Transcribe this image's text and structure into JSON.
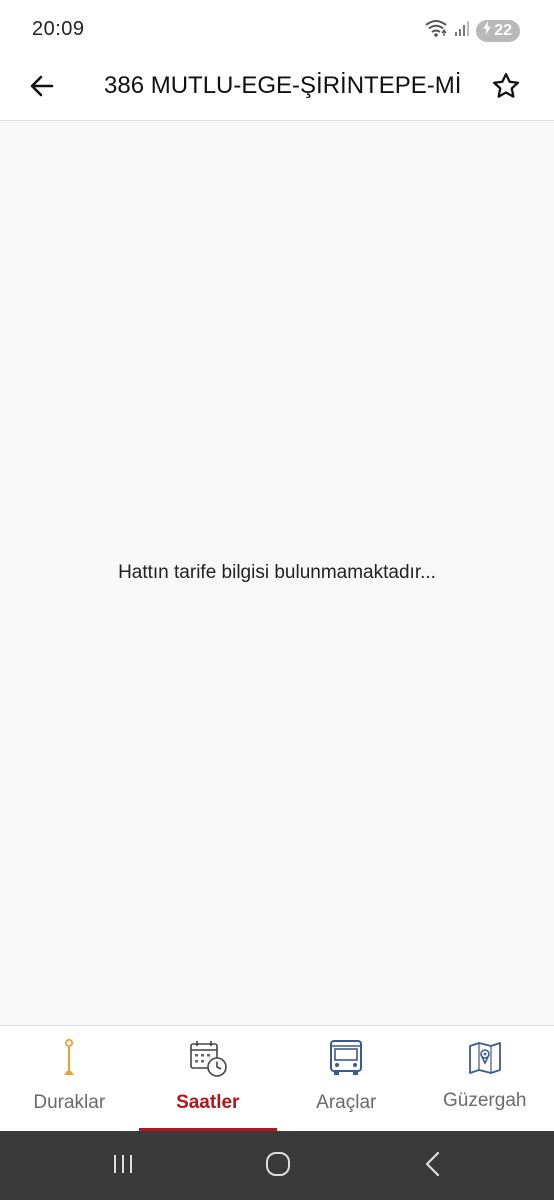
{
  "status_bar": {
    "time": "20:09",
    "battery": "22",
    "icons": [
      "wifi-icon",
      "signal-icon",
      "battery-charging-icon"
    ]
  },
  "app_bar": {
    "title": "386 MUTLU-EGE-ŞİRİNTEPE-Mİ",
    "back_icon": "arrow-left-icon",
    "favorite_icon": "star-outline-icon"
  },
  "content": {
    "empty_message": "Hattın tarife bilgisi bulunmamaktadır..."
  },
  "bottom_nav": {
    "active_index": 1,
    "items": [
      {
        "label": "Duraklar",
        "icon": "bus-stop-icon"
      },
      {
        "label": "Saatler",
        "icon": "calendar-clock-icon"
      },
      {
        "label": "Araçlar",
        "icon": "bus-icon"
      },
      {
        "label": "Güzergah",
        "icon": "route-map-icon"
      }
    ]
  },
  "system_nav": {
    "buttons": [
      "recents-icon",
      "home-icon",
      "back-icon"
    ]
  },
  "colors": {
    "accent": "#b3151b",
    "icon_blue": "#3d5a8a",
    "icon_orange": "#e8a23a",
    "background": "#f8f8f8",
    "system_nav": "#3a3a3a"
  }
}
